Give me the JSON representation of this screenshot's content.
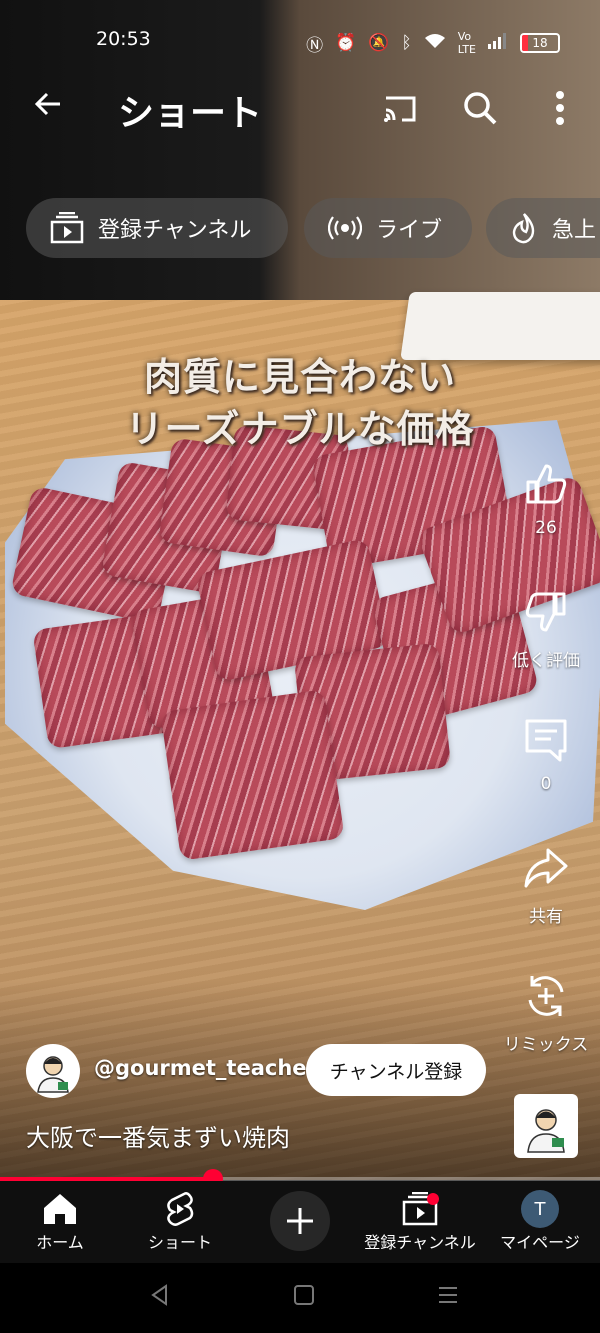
{
  "status_bar": {
    "time": "20:53",
    "battery": "18",
    "icons": [
      "nfc-icon",
      "alarm-icon",
      "mute-icon",
      "bluetooth-icon",
      "wifi-icon",
      "volte-icon",
      "signal-icon",
      "battery-icon"
    ]
  },
  "topbar": {
    "title": "ショート",
    "icons": [
      "back-arrow-icon",
      "cast-icon",
      "search-icon",
      "more-vert-icon"
    ]
  },
  "chips": [
    {
      "label": "登録チャンネル",
      "icon": "subscriptions-icon"
    },
    {
      "label": "ライブ",
      "icon": "live-icon"
    },
    {
      "label": "急上",
      "icon": "trending-icon"
    }
  ],
  "video": {
    "overlay_line1": "肉質に見合わない",
    "overlay_line2": "リーズナブルな価格"
  },
  "actions": {
    "like_count": "26",
    "dislike_label": "低く評価",
    "comment_count": "0",
    "share_label": "共有",
    "remix_label": "リミックス"
  },
  "channel": {
    "handle": "@gourmet_teacher",
    "subscribe_label": "チャンネル登録",
    "caption": "大阪で一番気まずい焼肉"
  },
  "progress": {
    "fraction": 0.355
  },
  "bottom_nav": {
    "home": "ホーム",
    "shorts": "ショート",
    "subscriptions": "登録チャンネル",
    "mypage": "マイページ",
    "avatar_letter": "T"
  },
  "colors": {
    "accent": "#ff0033",
    "nav_bg": "#0f0f0f"
  }
}
